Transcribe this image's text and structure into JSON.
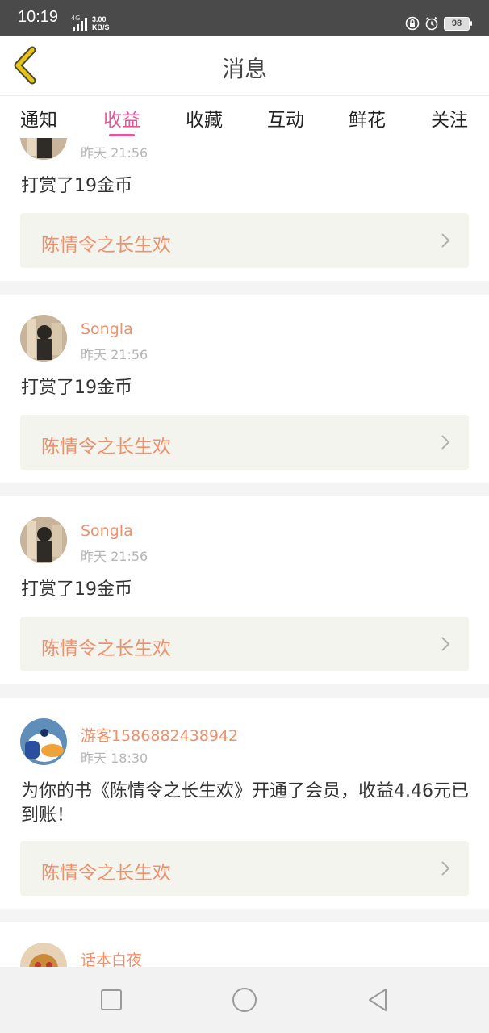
{
  "status_bar": {
    "time": "10:19",
    "network": "4G",
    "speed_value": "3.00",
    "speed_unit": "KB/S",
    "battery": "98"
  },
  "header": {
    "title": "消息",
    "back_icon": "back-chevron-icon"
  },
  "tabs": [
    {
      "label": "通知",
      "active": false
    },
    {
      "label": "收益",
      "active": true
    },
    {
      "label": "收藏",
      "active": false
    },
    {
      "label": "互动",
      "active": false
    },
    {
      "label": "鲜花",
      "active": false
    },
    {
      "label": "关注",
      "active": false
    }
  ],
  "cards": [
    {
      "username": "",
      "time": "昨天 21:56",
      "message": "打赏了19金币",
      "book": "陈情令之长生欢"
    },
    {
      "username": "Songla",
      "time": "昨天 21:56",
      "message": "打赏了19金币",
      "book": "陈情令之长生欢"
    },
    {
      "username": "Songla",
      "time": "昨天 21:56",
      "message": "打赏了19金币",
      "book": "陈情令之长生欢"
    },
    {
      "username": "游客1586882438942",
      "time": "昨天 18:30",
      "message": "为你的书《陈情令之长生欢》开通了会员，收益4.46元已到账！",
      "book": "陈情令之长生欢"
    },
    {
      "username": "话本白夜",
      "time": "",
      "message": "",
      "book": ""
    }
  ],
  "colors": {
    "accent": "#e2589a",
    "username": "#f0906a",
    "back_icon": "#e7c21a"
  }
}
